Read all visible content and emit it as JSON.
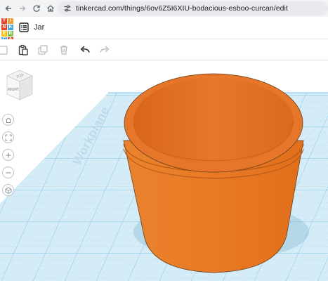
{
  "browser": {
    "url": "tinkercad.com/things/6ov6Z5I6XIU-bodacious-esboo-curcan/edit"
  },
  "app": {
    "logo_letters": [
      "T",
      "I",
      "N",
      "K",
      "E",
      "R",
      "C",
      "A",
      "D"
    ],
    "logo_colors": [
      "#e2462c",
      "#f39c32",
      "#e2462c",
      "#4aa8d8",
      "#f2c418",
      "#8cc152",
      "#4aa8d8",
      "#e2462c",
      "#4aa8d8"
    ],
    "title": "Jar"
  },
  "toolbar": {
    "icons": [
      "new-shape-icon",
      "paste-icon",
      "duplicate-icon",
      "delete-icon",
      "undo-icon",
      "redo-icon"
    ]
  },
  "viewcube": {
    "top_label": "TOP",
    "front_label": "RIGHT"
  },
  "viewport": {
    "workplane_label": "Workplane",
    "grid_color": "#cfe8f5",
    "object_color": "#e8792a"
  }
}
